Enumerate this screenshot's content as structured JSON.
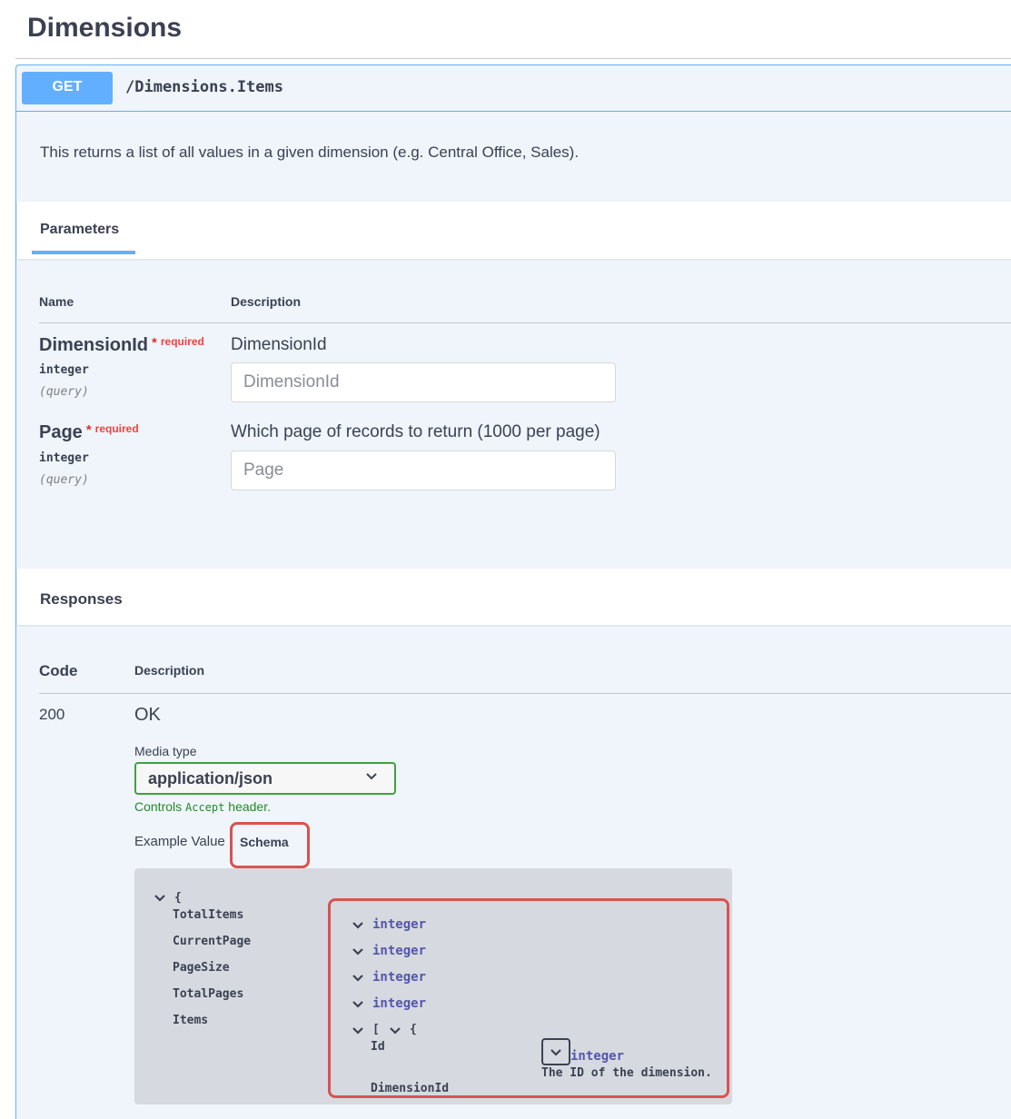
{
  "page": {
    "title": "Dimensions"
  },
  "operation": {
    "method": "GET",
    "path": "/Dimensions.Items",
    "description": "This returns a list of all values in a given dimension (e.g. Central Office, Sales)."
  },
  "parameters": {
    "tab_label": "Parameters",
    "col_name": "Name",
    "col_description": "Description",
    "required_star": "*",
    "required_label": "required",
    "items": [
      {
        "name": "DimensionId",
        "type": "integer",
        "in": "(query)",
        "description": "DimensionId",
        "placeholder": "DimensionId"
      },
      {
        "name": "Page",
        "type": "integer",
        "in": "(query)",
        "description": "Which page of records to return (1000 per page)",
        "placeholder": "Page"
      }
    ]
  },
  "responses": {
    "title": "Responses",
    "col_code": "Code",
    "col_description": "Description",
    "code": "200",
    "status": "OK",
    "media_type_label": "Media type",
    "media_type_value": "application/json",
    "controls_prefix": "Controls",
    "controls_code": "Accept",
    "controls_suffix": "header.",
    "tab_example": "Example Value",
    "tab_schema": "Schema"
  },
  "schema": {
    "open_brace": "{",
    "properties": [
      "TotalItems",
      "CurrentPage",
      "PageSize",
      "TotalPages",
      "Items"
    ],
    "types": [
      "integer",
      "integer",
      "integer",
      "integer"
    ],
    "items_open": "[",
    "items_inner_open": "{",
    "nested_properties": [
      "Id",
      "DimensionId"
    ],
    "id_type": "integer",
    "id_description": "The ID of the dimension."
  },
  "colors": {
    "get": "#61affe",
    "required": "#f93e3e",
    "valid_border": "#41a041",
    "highlight": "#d9534f"
  }
}
